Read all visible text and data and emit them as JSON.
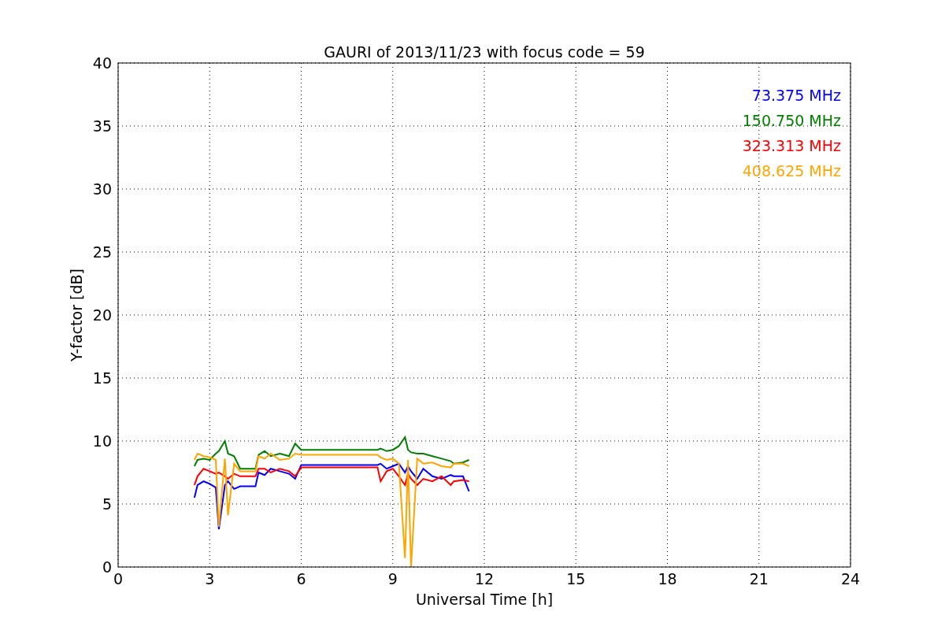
{
  "figure": {
    "chart_data": {
      "type": "line",
      "title": "GAURI of 2013/11/23 with focus code = 59",
      "xlabel": "Universal Time [h]",
      "ylabel": "Y-factor [dB]",
      "x": [
        2.5,
        2.6,
        2.8,
        3.0,
        3.2,
        3.3,
        3.5,
        3.6,
        3.8,
        4.0,
        4.5,
        4.6,
        4.8,
        5.0,
        5.3,
        5.6,
        5.8,
        6.0,
        8.5,
        8.6,
        8.8,
        9.0,
        9.2,
        9.4,
        9.5,
        9.6,
        9.8,
        10.0,
        10.3,
        10.6,
        10.9,
        11.0,
        11.3,
        11.5
      ],
      "series": [
        {
          "name": "73.375 MHz",
          "color": "#0000ff",
          "values": [
            5.5,
            6.5,
            6.8,
            6.6,
            6.3,
            3.0,
            6.5,
            6.8,
            6.2,
            6.4,
            6.4,
            7.5,
            7.3,
            7.8,
            7.6,
            7.4,
            7.0,
            8.1,
            8.1,
            8.2,
            7.8,
            8.0,
            8.2,
            7.5,
            8.0,
            7.6,
            7.0,
            7.8,
            7.2,
            7.0,
            7.3,
            7.2,
            7.2,
            6.0
          ]
        },
        {
          "name": "150.750 MHz",
          "color": "#008000",
          "values": [
            8.0,
            8.5,
            8.6,
            8.5,
            9.0,
            9.2,
            10.0,
            9.0,
            8.8,
            7.8,
            7.8,
            8.9,
            9.2,
            8.8,
            9.0,
            8.8,
            9.8,
            9.3,
            9.3,
            9.4,
            9.2,
            9.3,
            9.6,
            10.3,
            9.3,
            9.1,
            9.0,
            9.0,
            8.8,
            8.6,
            8.4,
            8.2,
            8.3,
            8.5
          ]
        },
        {
          "name": "323.313 MHz",
          "color": "#ff0000",
          "values": [
            6.5,
            7.2,
            7.8,
            7.6,
            7.4,
            7.5,
            7.2,
            7.0,
            7.4,
            7.2,
            7.2,
            7.8,
            7.8,
            7.5,
            7.8,
            7.6,
            7.2,
            7.9,
            7.9,
            6.8,
            7.6,
            7.8,
            7.2,
            6.5,
            7.4,
            7.0,
            6.5,
            7.0,
            6.8,
            7.2,
            6.5,
            6.8,
            6.9,
            6.8
          ]
        },
        {
          "name": "408.625 MHz",
          "color": "#ffa500",
          "values": [
            8.5,
            9.0,
            8.8,
            8.7,
            8.5,
            3.2,
            8.6,
            4.1,
            8.2,
            7.6,
            7.6,
            8.8,
            8.6,
            9.0,
            8.5,
            8.6,
            9.0,
            8.9,
            8.9,
            8.7,
            8.5,
            8.6,
            8.2,
            0.7,
            8.5,
            0,
            8.6,
            8.2,
            8.3,
            8.0,
            7.9,
            8.2,
            8.2,
            8.0
          ]
        }
      ],
      "xlim": [
        0,
        24
      ],
      "ylim": [
        0,
        40
      ],
      "xticks": [
        0,
        3,
        6,
        9,
        12,
        15,
        18,
        21,
        24
      ],
      "yticks": [
        0,
        5,
        10,
        15,
        20,
        25,
        30,
        35,
        40
      ],
      "grid": true
    }
  }
}
